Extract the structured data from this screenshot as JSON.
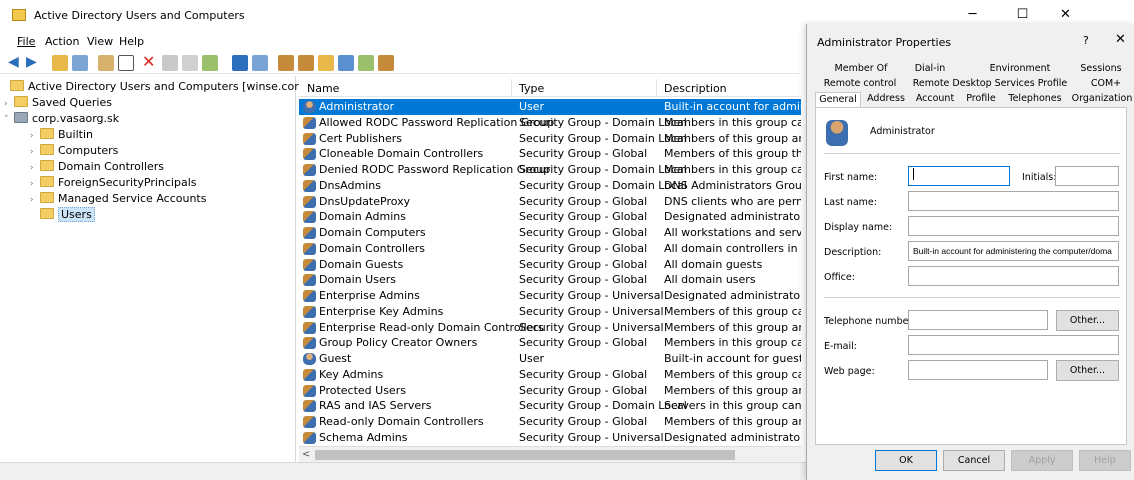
{
  "window": {
    "title": "Active Directory Users and Computers",
    "min": "─",
    "max": "☐",
    "close": "✕"
  },
  "menu": [
    "File",
    "Action",
    "View",
    "Help"
  ],
  "tree": {
    "root": "Active Directory Users and Computers [winse.corp.vasaorg.sk]",
    "saved_queries": "Saved Queries",
    "domain": "corp.vasaorg.sk",
    "children": [
      "Builtin",
      "Computers",
      "Domain Controllers",
      "ForeignSecurityPrincipals",
      "Managed Service Accounts",
      "Users"
    ]
  },
  "list": {
    "columns": [
      "Name",
      "Type",
      "Description"
    ],
    "rows": [
      {
        "name": "Administrator",
        "type": "User",
        "desc": "Built-in account for administeri",
        "icon": "user"
      },
      {
        "name": "Allowed RODC Password Replication Group",
        "type": "Security Group - Domain Local",
        "desc": "Members in this group can hav",
        "icon": "group"
      },
      {
        "name": "Cert Publishers",
        "type": "Security Group - Domain Local",
        "desc": "Members of this group are perr",
        "icon": "group"
      },
      {
        "name": "Cloneable Domain Controllers",
        "type": "Security Group - Global",
        "desc": "Members of this group that are",
        "icon": "group"
      },
      {
        "name": "Denied RODC Password Replication Group",
        "type": "Security Group - Domain Local",
        "desc": "Members in this group cannot l",
        "icon": "group"
      },
      {
        "name": "DnsAdmins",
        "type": "Security Group - Domain Local",
        "desc": "DNS Administrators Group",
        "icon": "group"
      },
      {
        "name": "DnsUpdateProxy",
        "type": "Security Group - Global",
        "desc": "DNS clients who are permitted t",
        "icon": "group"
      },
      {
        "name": "Domain Admins",
        "type": "Security Group - Global",
        "desc": "Designated administrators of th",
        "icon": "group"
      },
      {
        "name": "Domain Computers",
        "type": "Security Group - Global",
        "desc": "All workstations and servers joi",
        "icon": "group"
      },
      {
        "name": "Domain Controllers",
        "type": "Security Group - Global",
        "desc": "All domain controllers in the do",
        "icon": "group"
      },
      {
        "name": "Domain Guests",
        "type": "Security Group - Global",
        "desc": "All domain guests",
        "icon": "group"
      },
      {
        "name": "Domain Users",
        "type": "Security Group - Global",
        "desc": "All domain users",
        "icon": "group"
      },
      {
        "name": "Enterprise Admins",
        "type": "Security Group - Universal",
        "desc": "Designated administrators of th",
        "icon": "group"
      },
      {
        "name": "Enterprise Key Admins",
        "type": "Security Group - Universal",
        "desc": "Members of this group can perf",
        "icon": "group"
      },
      {
        "name": "Enterprise Read-only Domain Controllers",
        "type": "Security Group - Universal",
        "desc": "Members of this group are Reac",
        "icon": "group"
      },
      {
        "name": "Group Policy Creator Owners",
        "type": "Security Group - Global",
        "desc": "Members in this group can moc",
        "icon": "group"
      },
      {
        "name": "Guest",
        "type": "User",
        "desc": "Built-in account for guest acces",
        "icon": "user"
      },
      {
        "name": "Key Admins",
        "type": "Security Group - Global",
        "desc": "Members of this group can perf",
        "icon": "group"
      },
      {
        "name": "Protected Users",
        "type": "Security Group - Global",
        "desc": "Members of this group are affo",
        "icon": "group"
      },
      {
        "name": "RAS and IAS Servers",
        "type": "Security Group - Domain Local",
        "desc": "Servers in this group can access",
        "icon": "group"
      },
      {
        "name": "Read-only Domain Controllers",
        "type": "Security Group - Global",
        "desc": "Members of this group are Reac",
        "icon": "group"
      },
      {
        "name": "Schema Admins",
        "type": "Security Group - Universal",
        "desc": "Designated administrators of th",
        "icon": "group"
      }
    ]
  },
  "dialog": {
    "title": "Administrator Properties",
    "help": "?",
    "close": "✕",
    "tabs_row1": [
      "Member Of",
      "Dial-in",
      "Environment",
      "Sessions"
    ],
    "tabs_row2": [
      "Remote control",
      "Remote Desktop Services Profile",
      "COM+"
    ],
    "tabs_row3": [
      "General",
      "Address",
      "Account",
      "Profile",
      "Telephones",
      "Organization"
    ],
    "user_name": "Administrator",
    "fields": {
      "first_name": "First name:",
      "initials": "Initials:",
      "last_name": "Last name:",
      "display_name": "Display name:",
      "description": "Description:",
      "description_value": "Built-in account for administering the computer/doma",
      "office": "Office:",
      "telephone": "Telephone number:",
      "email": "E-mail:",
      "web_page": "Web page:"
    },
    "other1": "Other...",
    "other2": "Other...",
    "buttons": [
      "OK",
      "Cancel",
      "Apply",
      "Help"
    ]
  }
}
